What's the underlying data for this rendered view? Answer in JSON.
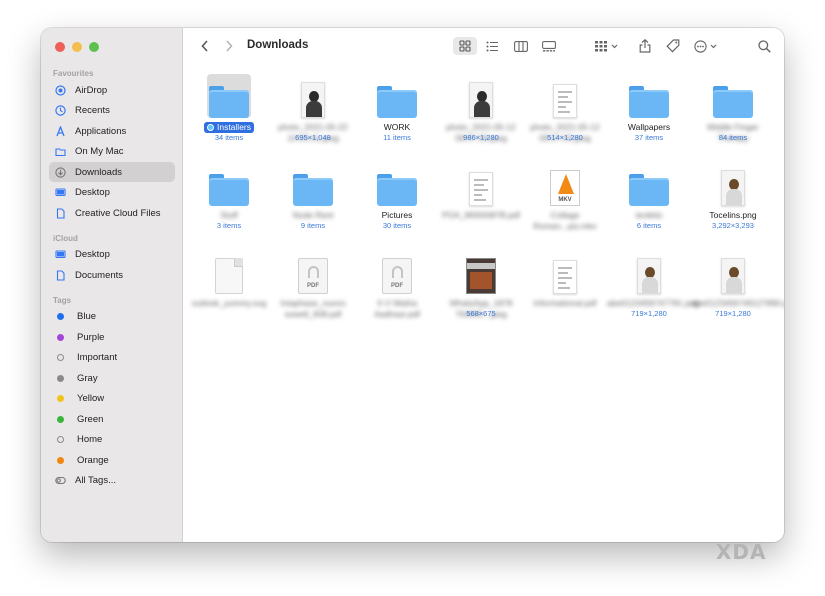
{
  "window": {
    "title": "Downloads"
  },
  "sidebar": {
    "sections": [
      {
        "heading": "Favourites",
        "items": [
          {
            "label": "AirDrop",
            "icon": "airdrop-icon"
          },
          {
            "label": "Recents",
            "icon": "clock-icon"
          },
          {
            "label": "Applications",
            "icon": "applications-icon"
          },
          {
            "label": "On My Mac",
            "icon": "folder-icon"
          },
          {
            "label": "Downloads",
            "icon": "download-icon",
            "active": true
          },
          {
            "label": "Desktop",
            "icon": "desktop-icon"
          },
          {
            "label": "Creative Cloud Files",
            "icon": "document-icon"
          }
        ]
      },
      {
        "heading": "iCloud",
        "items": [
          {
            "label": "Desktop",
            "icon": "desktop-icon"
          },
          {
            "label": "Documents",
            "icon": "document-icon"
          }
        ]
      },
      {
        "heading": "Tags",
        "items": [
          {
            "label": "Blue",
            "color": "#1d6ff0"
          },
          {
            "label": "Purple",
            "color": "#a346d8"
          },
          {
            "label": "Important",
            "color": ""
          },
          {
            "label": "Gray",
            "color": "#8a8a8a"
          },
          {
            "label": "Yellow",
            "color": "#f1c21b"
          },
          {
            "label": "Green",
            "color": "#39b53a"
          },
          {
            "label": "Home",
            "color": ""
          },
          {
            "label": "Orange",
            "color": "#f2870e"
          },
          {
            "label": "All Tags...",
            "color": ""
          }
        ]
      }
    ]
  },
  "files": [
    [
      {
        "name": "Installers",
        "sub": "34 items",
        "kind": "folder",
        "selected": true
      },
      {
        "name": "photo_2021-05-22 10:03:41.jpeg",
        "sub": "695×1,048",
        "kind": "photo-dark",
        "blurred": true
      },
      {
        "name": "WORK",
        "sub": "11 items",
        "kind": "folder"
      },
      {
        "name": "photo_2021-05-12 08:57:09.jpeg",
        "sub": "986×1,280",
        "kind": "photo-dark",
        "blurred": true
      },
      {
        "name": "photo_2021-05-12 08:57:03.jpeg",
        "sub": "514×1,280",
        "kind": "doc",
        "blurred": true
      },
      {
        "name": "Wallpapers",
        "sub": "37 items",
        "kind": "folder"
      },
      {
        "name": "Middle Finger Therapy",
        "sub": "84 items",
        "kind": "folder",
        "blurred": true
      }
    ],
    [
      {
        "name": "Stuff",
        "sub": "3 items",
        "kind": "folder",
        "blurred": true
      },
      {
        "name": "Node Rent",
        "sub": "9 items",
        "kind": "folder",
        "blurred": true
      },
      {
        "name": "Pictures",
        "sub": "30 items",
        "kind": "folder"
      },
      {
        "name": "POA_M000087B.pdf",
        "sub": "",
        "kind": "doc",
        "blurred": true
      },
      {
        "name": "Collage Roman...pis.mkv",
        "sub": "",
        "kind": "mkv",
        "blurred": true
      },
      {
        "name": "textkits",
        "sub": "6 items",
        "kind": "folder",
        "blurred": true
      },
      {
        "name": "Tocelins.png",
        "sub": "3,292×3,293",
        "kind": "photo-white"
      }
    ],
    [
      {
        "name": "outlook_yummy.svg",
        "sub": "",
        "kind": "generic",
        "blurred": true
      },
      {
        "name": "Intaphase_nuovo sowell_608.pdf",
        "sub": "",
        "kind": "pdf",
        "blurred": true
      },
      {
        "name": "X-V Matha Aadhaar.pdf",
        "sub": "",
        "kind": "pdf",
        "blurred": true
      },
      {
        "name": "WhatsApp_1878 764865...jpeg",
        "sub": "568×675",
        "kind": "cover",
        "blurred": true
      },
      {
        "name": "Informational.pdf",
        "sub": "",
        "kind": "doc",
        "blurred": true
      },
      {
        "name": "abe0123456747781.png",
        "sub": "719×1,280",
        "kind": "photo-white",
        "blurred": true
      },
      {
        "name": "abe0123456749127890.png",
        "sub": "719×1,280",
        "kind": "photo-white",
        "blurred": true
      }
    ]
  ],
  "watermark": "XDA",
  "colors": {
    "accent": "#2f6fe0",
    "folder": "#6bb6f5",
    "sidebar": "#e9e7e8"
  }
}
